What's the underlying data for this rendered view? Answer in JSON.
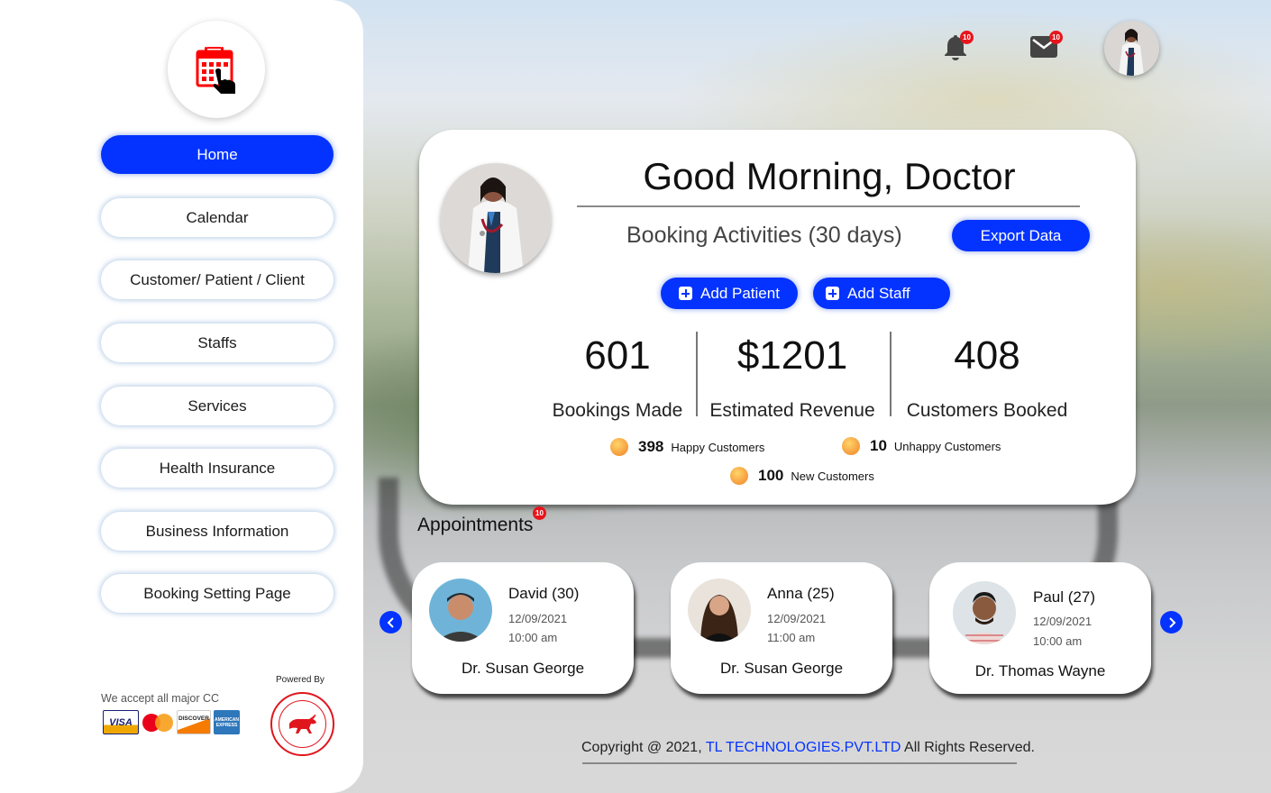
{
  "sidebar": {
    "logo_icon": "calendar-touch-icon",
    "nav": [
      {
        "label": "Home",
        "active": true
      },
      {
        "label": "Calendar",
        "active": false
      },
      {
        "label": "Customer/ Patient / Client",
        "active": false
      },
      {
        "label": "Staffs",
        "active": false
      },
      {
        "label": "Services",
        "active": false
      },
      {
        "label": "Health Insurance",
        "active": false
      },
      {
        "label": "Business Information",
        "active": false
      },
      {
        "label": "Booking Setting Page",
        "active": false
      }
    ],
    "cc_label": "We accept all major CC",
    "cards": [
      "VISA",
      "MasterCard",
      "DISCOVER",
      "AMERICAN EXPRESS"
    ],
    "powered_by": "Powered By",
    "powered_logo": "TL TECHNOLOGIES"
  },
  "topbar": {
    "notifications_badge": "10",
    "messages_badge": "10"
  },
  "dashboard": {
    "greeting": "Good Morning, Doctor",
    "subtitle": "Booking Activities (30 days)",
    "export_label": "Export Data",
    "add_patient_label": "Add Patient",
    "add_staff_label": "Add Staff",
    "stats": [
      {
        "value": "601",
        "label": "Bookings Made"
      },
      {
        "value": "$1201",
        "label": "Estimated Revenue"
      },
      {
        "value": "408",
        "label": "Customers Booked"
      }
    ],
    "mini_stats": [
      {
        "value": "398",
        "label": "Happy Customers",
        "mood": "happy"
      },
      {
        "value": "10",
        "label": "Unhappy Customers",
        "mood": "sad"
      },
      {
        "value": "100",
        "label": "New Customers",
        "mood": "happy"
      }
    ]
  },
  "appointments": {
    "title": "Appointments",
    "badge": "10",
    "items": [
      {
        "name": "David (30)",
        "date": "12/09/2021",
        "time": "10:00 am",
        "doctor": "Dr. Susan George"
      },
      {
        "name": "Anna (25)",
        "date": "12/09/2021",
        "time": "11:00 am",
        "doctor": "Dr. Susan George"
      },
      {
        "name": "Paul (27)",
        "date": "12/09/2021",
        "time": "10:00 am",
        "doctor": "Dr. Thomas Wayne"
      }
    ]
  },
  "footer": {
    "prefix": "Copyright @ 2021, ",
    "company": "TL TECHNOLOGIES.PVT.LTD",
    "suffix": " All Rights Reserved."
  },
  "colors": {
    "accent": "#0433ff",
    "badge": "#e8141b",
    "logo_red": "#e0161d"
  }
}
